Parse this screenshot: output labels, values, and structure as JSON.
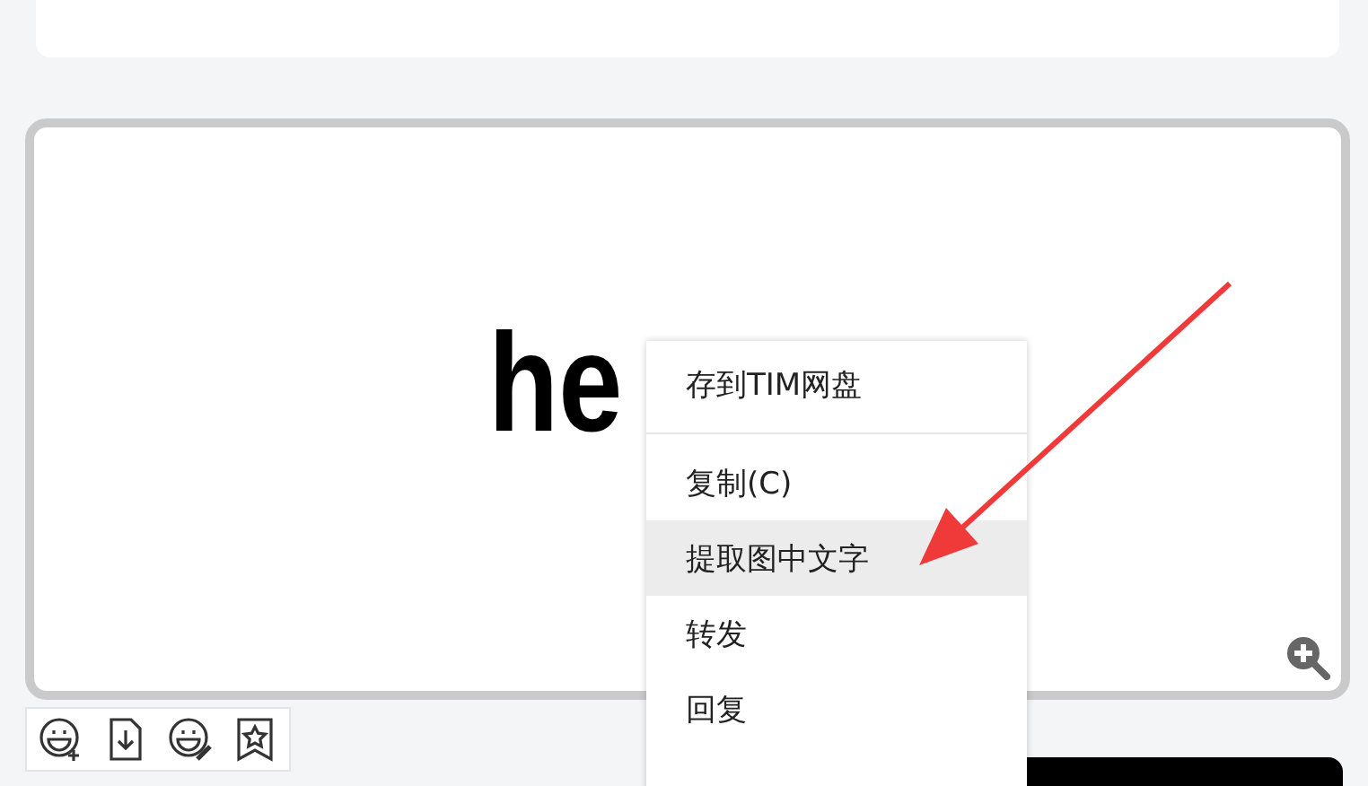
{
  "message": {
    "image_text": "he"
  },
  "toolbar": {
    "buttons": [
      {
        "kind": "emoji-add"
      },
      {
        "kind": "download"
      },
      {
        "kind": "emoji-edit"
      },
      {
        "kind": "bookmark"
      }
    ]
  },
  "context_menu": {
    "items": [
      {
        "kind": "item",
        "label": "存到TIM网盘",
        "selected": false
      },
      {
        "kind": "separator"
      },
      {
        "kind": "item",
        "label": "复制(C)",
        "selected": false
      },
      {
        "kind": "item",
        "label": "提取图中文字",
        "selected": true
      },
      {
        "kind": "item",
        "label": "转发",
        "selected": false
      },
      {
        "kind": "item",
        "label": "回复",
        "selected": false
      }
    ]
  }
}
